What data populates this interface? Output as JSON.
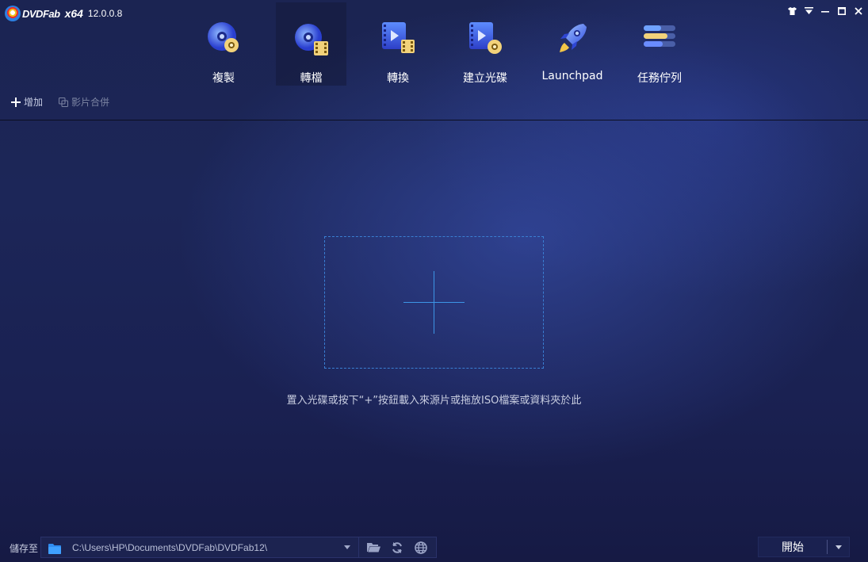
{
  "app": {
    "name": "DVDFab",
    "arch": "x64",
    "version": "12.0.0.8"
  },
  "window_controls": [
    "skin-icon",
    "menu-icon",
    "minimize-icon",
    "maximize-icon",
    "close-icon"
  ],
  "tabs": [
    {
      "label": "複製",
      "icon": "copy-disc-icon",
      "active": false
    },
    {
      "label": "轉檔",
      "icon": "convert-disc-icon",
      "active": true
    },
    {
      "label": "轉換",
      "icon": "convert-video-icon",
      "active": false
    },
    {
      "label": "建立光碟",
      "icon": "create-disc-icon",
      "active": false
    },
    {
      "label": "Launchpad",
      "icon": "rocket-icon",
      "active": false
    },
    {
      "label": "任務佇列",
      "icon": "task-queue-icon",
      "active": false
    }
  ],
  "toolbar": {
    "add_label": "增加",
    "merge_label": "影片合併"
  },
  "dropzone": {
    "hint": "置入光碟或按下“+”按鈕載入來源片或拖放ISO檔案或資料夾於此"
  },
  "bottom": {
    "save_to_label": "儲存至",
    "path": "C:\\Users\\HP\\Documents\\DVDFab\\DVDFab12\\",
    "start_label": "開始"
  },
  "colors": {
    "accent": "#3d95e6",
    "background": "#1c2658",
    "text": "#ffffff"
  }
}
